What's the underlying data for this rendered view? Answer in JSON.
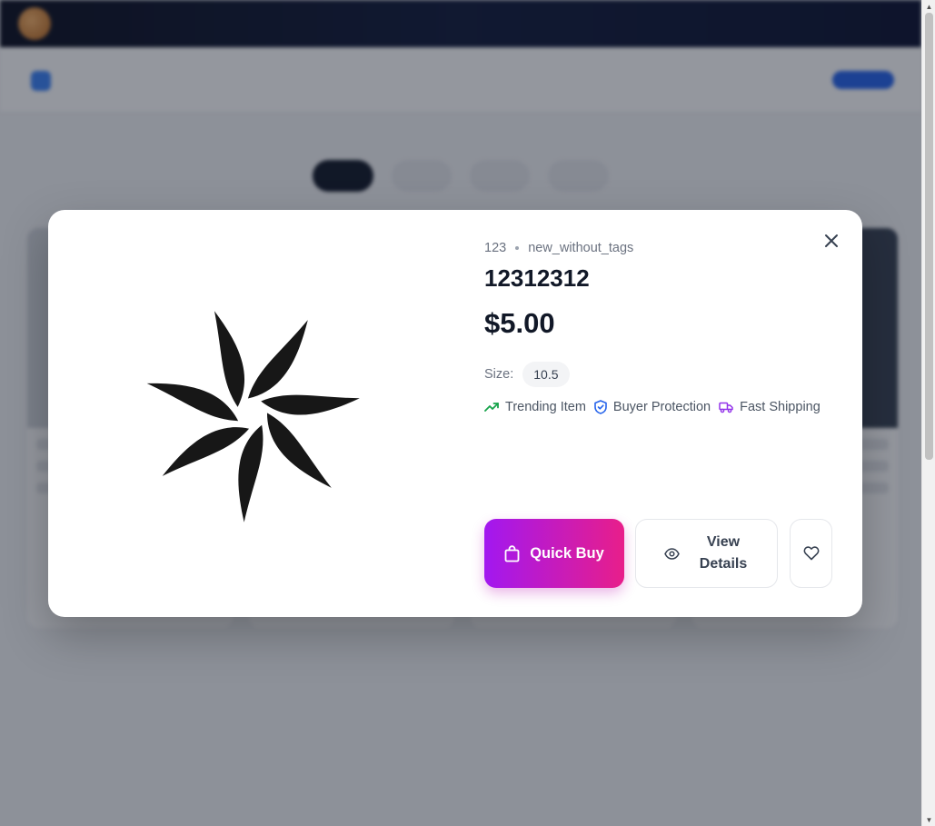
{
  "background": {
    "promo_text": "",
    "nav_center": "",
    "nav_login": "",
    "nav_signup": "",
    "search_placeholder": "",
    "sort_label": ""
  },
  "modal": {
    "brand": "123",
    "condition": "new_without_tags",
    "title": "12312312",
    "price": "$5.00",
    "size_label": "Size:",
    "size_value": "10.5",
    "features": [
      {
        "label": "Trending Item",
        "icon": "trending-up-icon",
        "color": "#16a34a"
      },
      {
        "label": "Buyer Protection",
        "icon": "shield-check-icon",
        "color": "#2563eb"
      },
      {
        "label": "Fast Shipping",
        "icon": "truck-icon",
        "color": "#9333ea"
      }
    ],
    "quick_buy_label": "Quick Buy",
    "view_details_label": "View Details",
    "product_image_icon": "pinwheel-logo-icon"
  },
  "colors": {
    "quick_buy_gradient_start": "#a218f0",
    "quick_buy_gradient_end": "#e81e8a",
    "title_text": "#111827",
    "muted_text": "#6b7280"
  }
}
